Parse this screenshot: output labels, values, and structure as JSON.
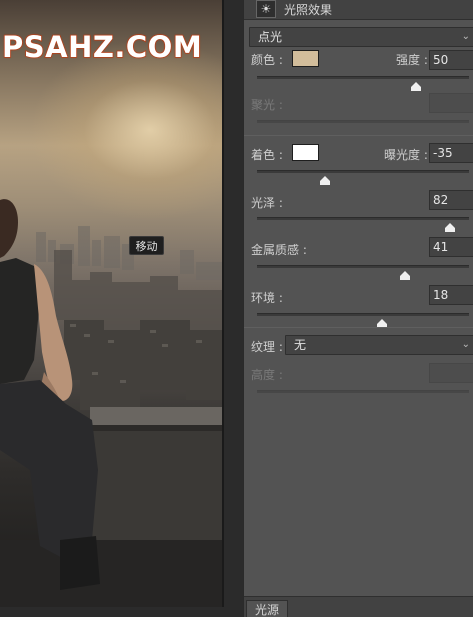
{
  "canvas": {
    "watermark": "PSAHZ.COM",
    "tooltip": "移动"
  },
  "panel": {
    "title": "光照效果",
    "light_type": "点光",
    "color_label": "颜色 :",
    "color_swatch": "#d2bd9b",
    "intensity_label": "强度 :",
    "intensity_value": "50",
    "intensity_level": 0.75,
    "hotspot_label": "聚光 :",
    "hotspot_value": "",
    "hotspot_level": 0.0,
    "colorize_label": "着色 :",
    "colorize_swatch": "#ffffff",
    "exposure_label": "曝光度 :",
    "exposure_value": "-35",
    "exposure_level": 0.32,
    "gloss_label": "光泽 :",
    "gloss_value": "82",
    "gloss_level": 0.91,
    "metallic_label": "金属质感 :",
    "metallic_value": "41",
    "metallic_level": 0.7,
    "ambience_label": "环境 :",
    "ambience_value": "18",
    "ambience_level": 0.59,
    "texture_label": "纹理 :",
    "texture_value": "无",
    "height_label": "高度 :",
    "height_value": "",
    "bottom_tab": "光源"
  },
  "colors": {
    "panel_bg": "#535353",
    "field_bg": "#434343",
    "watermark_stroke": "#b4401a"
  }
}
